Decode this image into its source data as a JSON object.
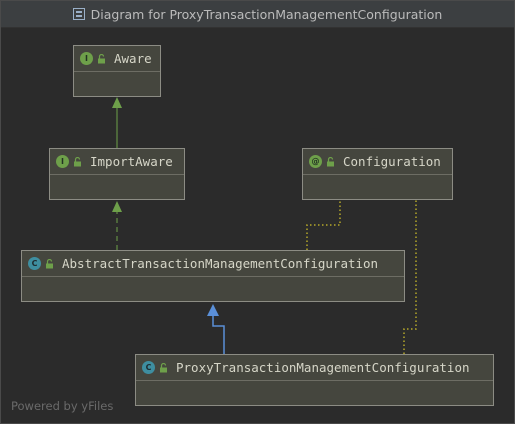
{
  "window": {
    "title": "Diagram for ProxyTransactionManagementConfiguration",
    "footer": "Powered by yFiles"
  },
  "nodes": {
    "aware": {
      "kind": "interface",
      "badge": "I",
      "label": "Aware"
    },
    "importaware": {
      "kind": "interface",
      "badge": "I",
      "label": "ImportAware"
    },
    "configuration": {
      "kind": "annotation",
      "badge": "@",
      "label": "Configuration"
    },
    "abstract": {
      "kind": "abstract-class",
      "badge": "C",
      "label": "AbstractTransactionManagementConfiguration"
    },
    "proxy": {
      "kind": "class",
      "badge": "C",
      "label": "ProxyTransactionManagementConfiguration"
    }
  },
  "colors": {
    "background": "#2b2b2b",
    "node_fill": "#45463e",
    "implements_edge": "#6ea04a",
    "extends_edge": "#5a8fd8",
    "annotation_edge": "#b4a82a"
  }
}
